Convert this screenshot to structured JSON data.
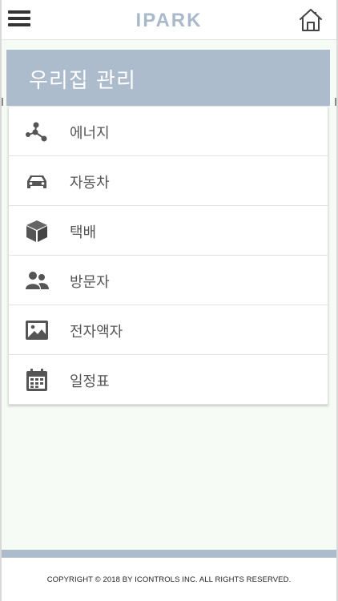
{
  "header": {
    "logo": "IPARK",
    "menu_icon": "hamburger-menu-icon",
    "home_icon": "home-icon"
  },
  "page": {
    "title": "우리집 관리"
  },
  "menu": {
    "items": [
      {
        "label": "에너지",
        "icon": "energy-molecule-icon"
      },
      {
        "label": "자동차",
        "icon": "car-icon"
      },
      {
        "label": "택배",
        "icon": "package-box-icon"
      },
      {
        "label": "방문자",
        "icon": "visitors-icon"
      },
      {
        "label": "전자액자",
        "icon": "picture-frame-icon"
      },
      {
        "label": "일정표",
        "icon": "calendar-icon"
      }
    ]
  },
  "footer": {
    "copyright": "COPYRIGHT © 2018 BY ICONTROLS INC. ALL RIGHTS RESERVED."
  },
  "colors": {
    "accent": "#adbccd",
    "logo": "#a9b9c9",
    "icon": "#555555",
    "background": "#f6fbf6"
  }
}
